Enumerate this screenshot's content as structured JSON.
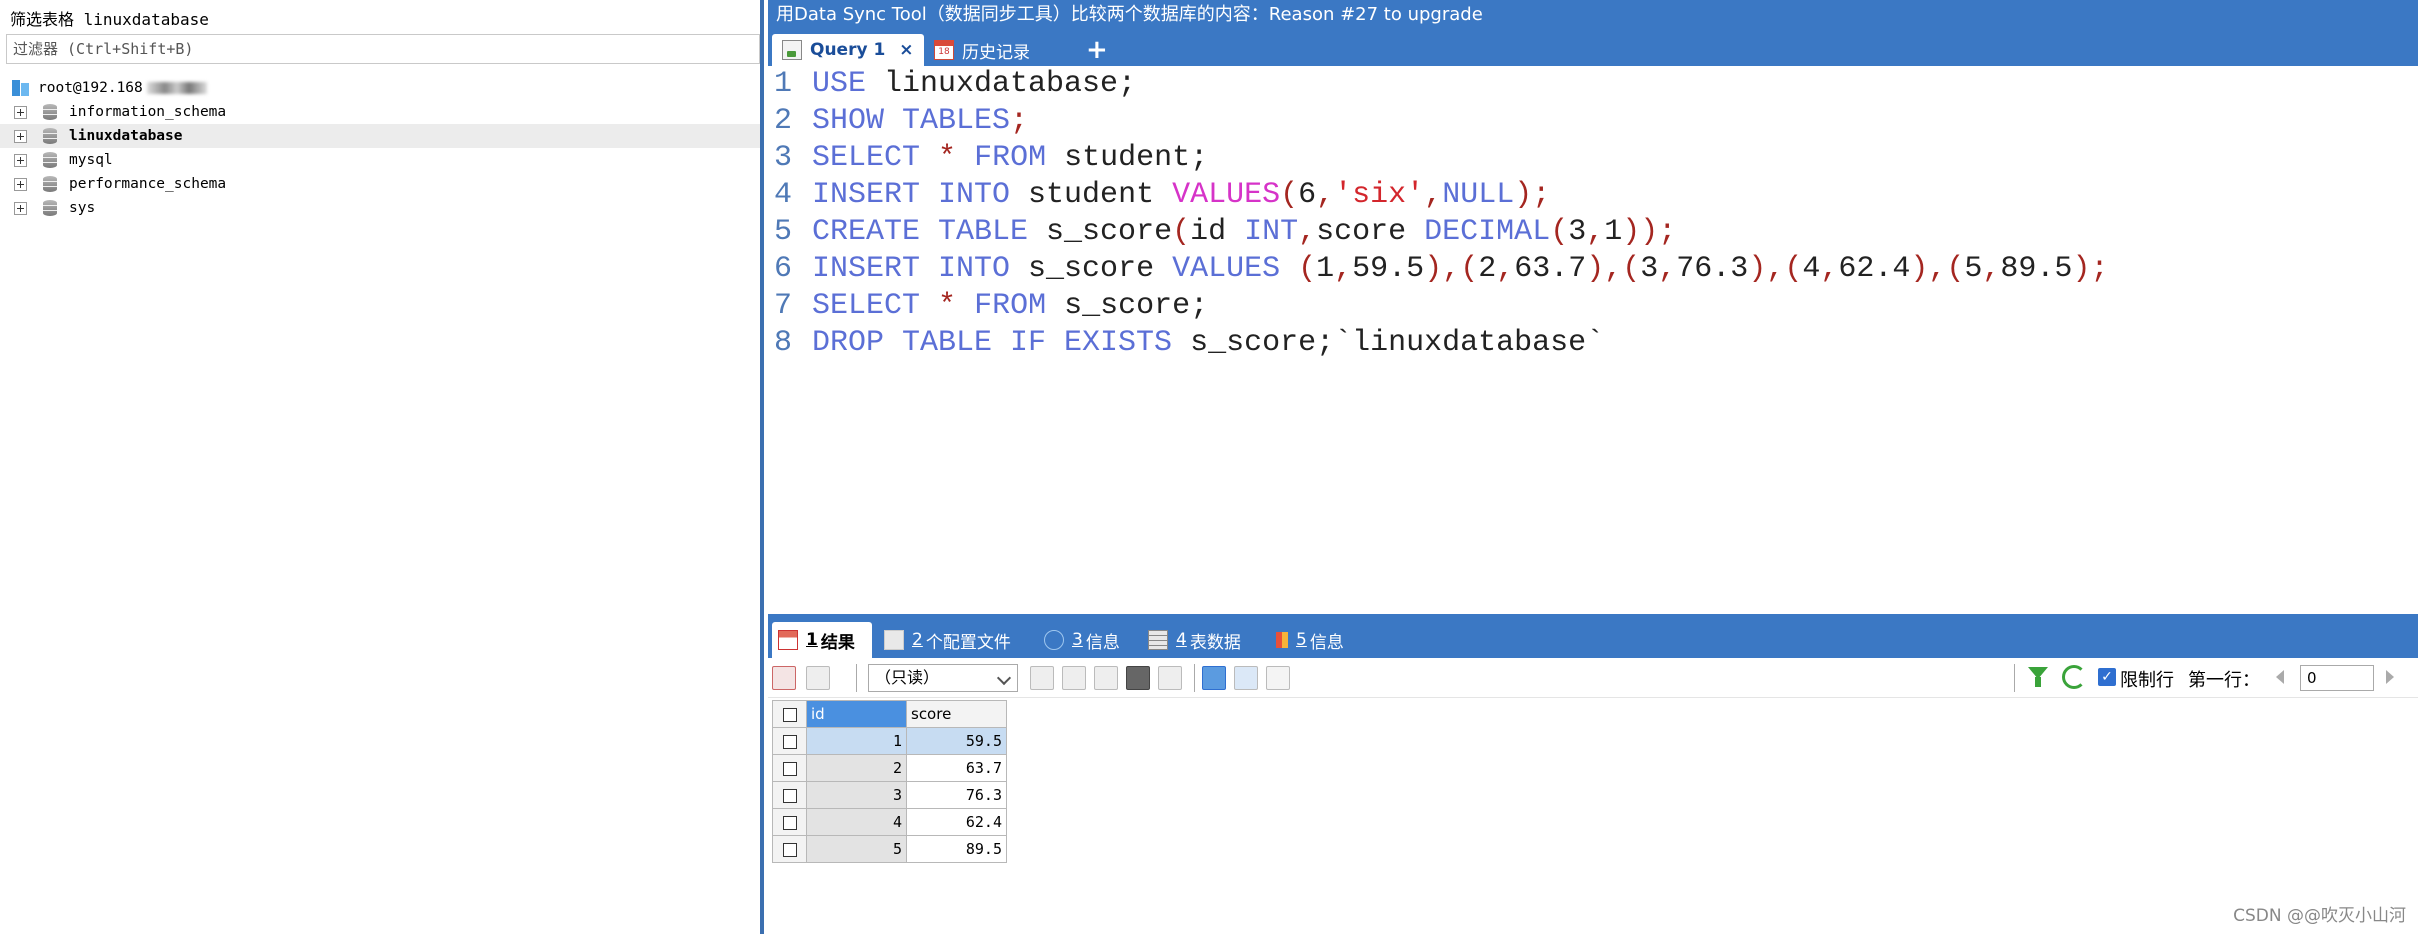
{
  "left_panel": {
    "filter_title": "筛选表格 linuxdatabase",
    "filter_placeholder": "过滤器 (Ctrl+Shift+B)",
    "connection": "root@192.168",
    "databases": [
      {
        "name": "information_schema",
        "selected": false
      },
      {
        "name": "linuxdatabase",
        "selected": true
      },
      {
        "name": "mysql",
        "selected": false
      },
      {
        "name": "performance_schema",
        "selected": false
      },
      {
        "name": "sys",
        "selected": false
      }
    ]
  },
  "titlebar": {
    "text": "用Data Sync Tool（数据同步工具）比较两个数据库的内容：Reason #27 to upgrade"
  },
  "tabs": {
    "query_label": "Query 1",
    "close": "×",
    "history_icon": "18",
    "history_label": "历史记录",
    "add": "+"
  },
  "editor": {
    "line_numbers": [
      "1",
      "2",
      "3",
      "4",
      "5",
      "6",
      "7",
      "8"
    ]
  },
  "result_tabs": [
    {
      "num": "1",
      "label": "结果"
    },
    {
      "num": "2",
      "label": "个配置文件"
    },
    {
      "num": "3",
      "label": "信息"
    },
    {
      "num": "4",
      "label": "表数据"
    },
    {
      "num": "5",
      "label": "信息"
    }
  ],
  "toolbar": {
    "readonly_select": "（只读）",
    "limit_label": "限制行",
    "limit_checked": true,
    "first_row_label": "第一行：",
    "first_row_value": "0"
  },
  "grid": {
    "columns": [
      "id",
      "score"
    ],
    "rows": [
      {
        "id": "1",
        "score": "59.5"
      },
      {
        "id": "2",
        "score": "63.7"
      },
      {
        "id": "3",
        "score": "76.3"
      },
      {
        "id": "4",
        "score": "62.4"
      },
      {
        "id": "5",
        "score": "89.5"
      }
    ]
  },
  "watermark": "CSDN @@吹灭小山河",
  "colors": {
    "titlebar": "#3b78c4",
    "keyword": "#5b6fd6",
    "string": "#d3262c",
    "function": "#d633c8"
  }
}
